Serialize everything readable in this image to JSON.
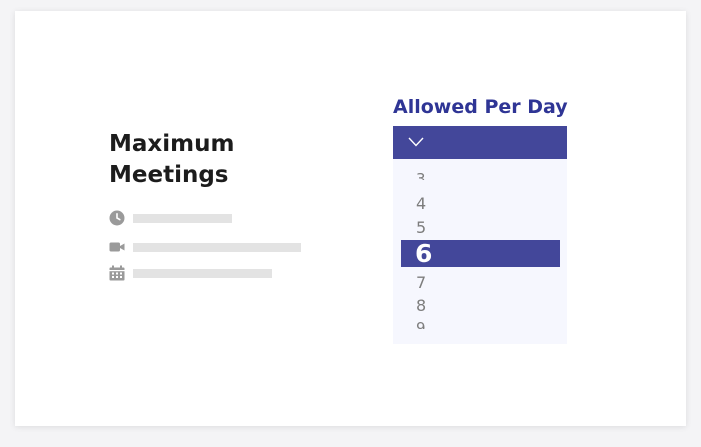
{
  "card": {
    "title_line1": "Maximum",
    "title_line2": "Meetings",
    "details": [
      {
        "icon": "clock-icon"
      },
      {
        "icon": "video-camera-icon"
      },
      {
        "icon": "calendar-icon"
      }
    ]
  },
  "picker": {
    "label": "Allowed Per Day",
    "header_icon": "chevron-down-icon",
    "options": [
      "3",
      "4",
      "5",
      "6",
      "7",
      "8",
      "9"
    ],
    "selected": "6"
  },
  "colors": {
    "accent": "#43479a",
    "label": "#2f3595",
    "list_bg": "#f6f7fe",
    "placeholder_bar": "#e3e3e3",
    "icon_gray": "#9a9a9a"
  }
}
